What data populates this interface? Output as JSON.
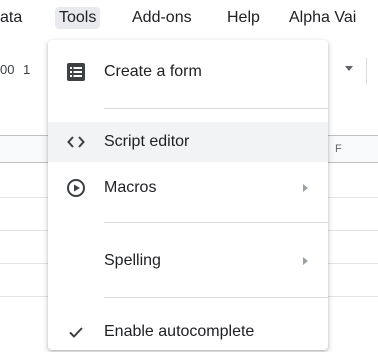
{
  "menubar": {
    "items": [
      {
        "label": "ata"
      },
      {
        "label": "Tools"
      },
      {
        "label": "Add-ons"
      },
      {
        "label": "Help"
      },
      {
        "label": "Alpha Vai"
      }
    ]
  },
  "toolbar": {
    "left_text_a": "00",
    "left_text_b": "1"
  },
  "sheet": {
    "column_letter": "F"
  },
  "tools_menu": {
    "items": [
      {
        "label": "Create a form",
        "icon": "form-icon"
      },
      {
        "label": "Script editor",
        "icon": "code-brackets-icon"
      },
      {
        "label": "Macros",
        "icon": "play-circle-icon",
        "has_submenu": true
      },
      {
        "label": "Spelling",
        "has_submenu": true
      },
      {
        "label": "Enable autocomplete",
        "icon": "checkmark-icon"
      }
    ]
  },
  "colors": {
    "menu_hover": "#f1f3f4",
    "active_menubar": "#e8eaed",
    "text": "#202124",
    "icon": "#3c4043"
  }
}
